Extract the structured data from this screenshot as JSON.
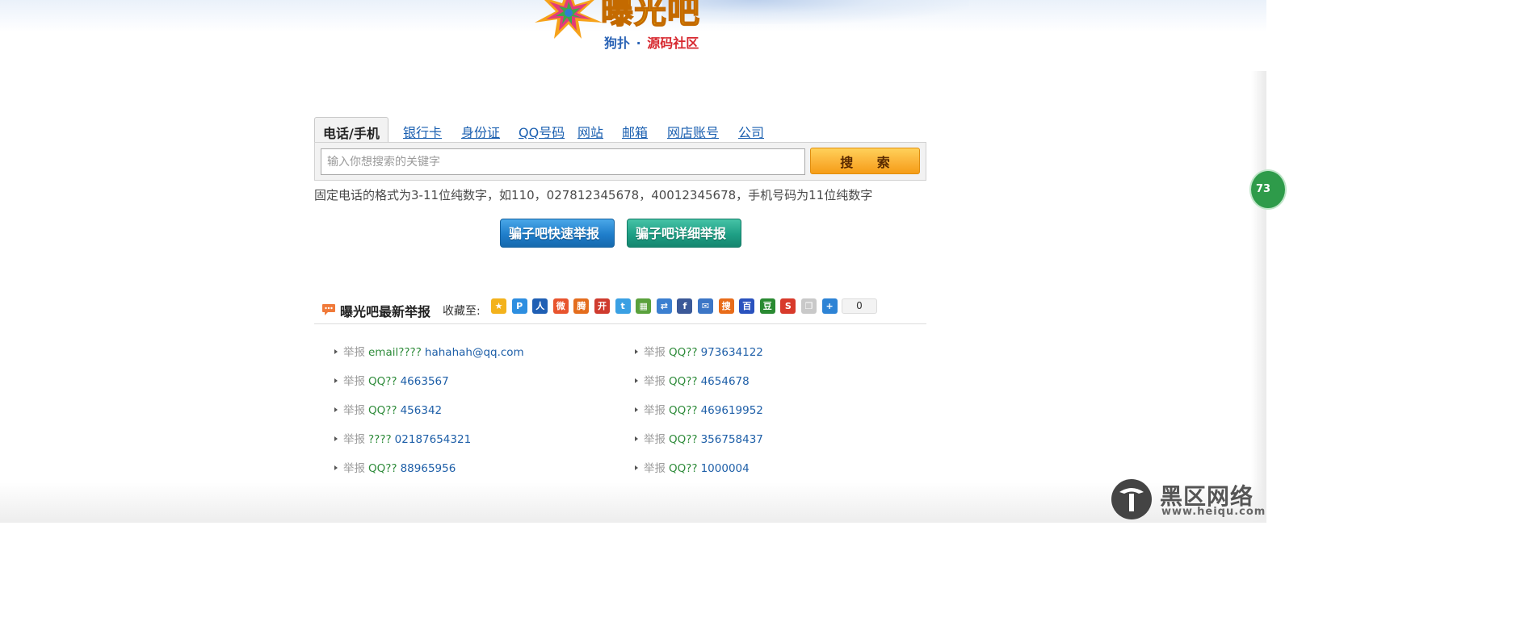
{
  "logo": {
    "title": "曝光吧",
    "subtitle_left": "狗扑",
    "subtitle_dot": "·",
    "subtitle_right": "源码社区",
    "star_icon": "colorful-star-icon"
  },
  "search": {
    "tabs": [
      {
        "label": "电话/手机",
        "active": true
      },
      {
        "label": "银行卡",
        "active": false
      },
      {
        "label": "身份证",
        "active": false
      },
      {
        "label": "QQ号码",
        "active": false
      },
      {
        "label": "网站",
        "active": false
      },
      {
        "label": "邮箱",
        "active": false
      },
      {
        "label": "网店账号",
        "active": false
      },
      {
        "label": "公司",
        "active": false
      }
    ],
    "placeholder": "输入你想搜索的关键字",
    "value": "",
    "button_label": "搜 索",
    "hint": "固定电话的格式为3-11位纯数字，如110，027812345678，40012345678，手机号码为11位纯数字"
  },
  "report_buttons": {
    "quick": "骗子吧快速举报",
    "detailed": "骗子吧详细举报"
  },
  "latest": {
    "title": "曝光吧最新举报",
    "collect_label": "收藏至:",
    "share_count": "0",
    "share_icons": [
      {
        "name": "qzone-icon",
        "glyph": "★",
        "color": "#f3b21c"
      },
      {
        "name": "pengyou-icon",
        "glyph": "P",
        "color": "#2d8ee0"
      },
      {
        "name": "renren-icon",
        "glyph": "人",
        "color": "#1f5fb4"
      },
      {
        "name": "weibo-icon",
        "glyph": "微",
        "color": "#e8542e"
      },
      {
        "name": "tencent-weibo-icon",
        "glyph": "腾",
        "color": "#e46d1d"
      },
      {
        "name": "kaixin-icon",
        "glyph": "开",
        "color": "#cf3b2e"
      },
      {
        "name": "twitter-icon",
        "glyph": "t",
        "color": "#3aa0e3"
      },
      {
        "name": "pictures-icon",
        "glyph": "▦",
        "color": "#5aa13c"
      },
      {
        "name": "translate-icon",
        "glyph": "⇄",
        "color": "#3b7fd0"
      },
      {
        "name": "facebook-icon",
        "glyph": "f",
        "color": "#3b5998"
      },
      {
        "name": "mail-share-icon",
        "glyph": "✉",
        "color": "#3c76c6"
      },
      {
        "name": "sohu-icon",
        "glyph": "搜",
        "color": "#e86c1a"
      },
      {
        "name": "baidu-icon",
        "glyph": "百",
        "color": "#2a52be"
      },
      {
        "name": "douban-icon",
        "glyph": "豆",
        "color": "#2a8a32"
      },
      {
        "name": "sina-blog-icon",
        "glyph": "S",
        "color": "#d83a2b"
      },
      {
        "name": "copy-icon",
        "glyph": "❐",
        "color": "#c9c9c9"
      },
      {
        "name": "more-share-icon",
        "glyph": "+",
        "color": "#2d83d5"
      }
    ],
    "items_left": [
      {
        "tag": "举报",
        "kind": "email????",
        "value": "hahahah@qq.com"
      },
      {
        "tag": "举报",
        "kind": "QQ??",
        "value": "4663567"
      },
      {
        "tag": "举报",
        "kind": "QQ??",
        "value": "456342"
      },
      {
        "tag": "举报",
        "kind": "????",
        "value": "02187654321"
      },
      {
        "tag": "举报",
        "kind": "QQ??",
        "value": "88965956"
      }
    ],
    "items_right": [
      {
        "tag": "举报",
        "kind": "QQ??",
        "value": "973634122"
      },
      {
        "tag": "举报",
        "kind": "QQ??",
        "value": "4654678"
      },
      {
        "tag": "举报",
        "kind": "QQ??",
        "value": "469619952"
      },
      {
        "tag": "举报",
        "kind": "QQ??",
        "value": "356758437"
      },
      {
        "tag": "举报",
        "kind": "QQ??",
        "value": "1000004"
      }
    ]
  },
  "side_badge": "73",
  "watermark": {
    "name": "黑区网络",
    "url": "www.heiqu.com"
  }
}
